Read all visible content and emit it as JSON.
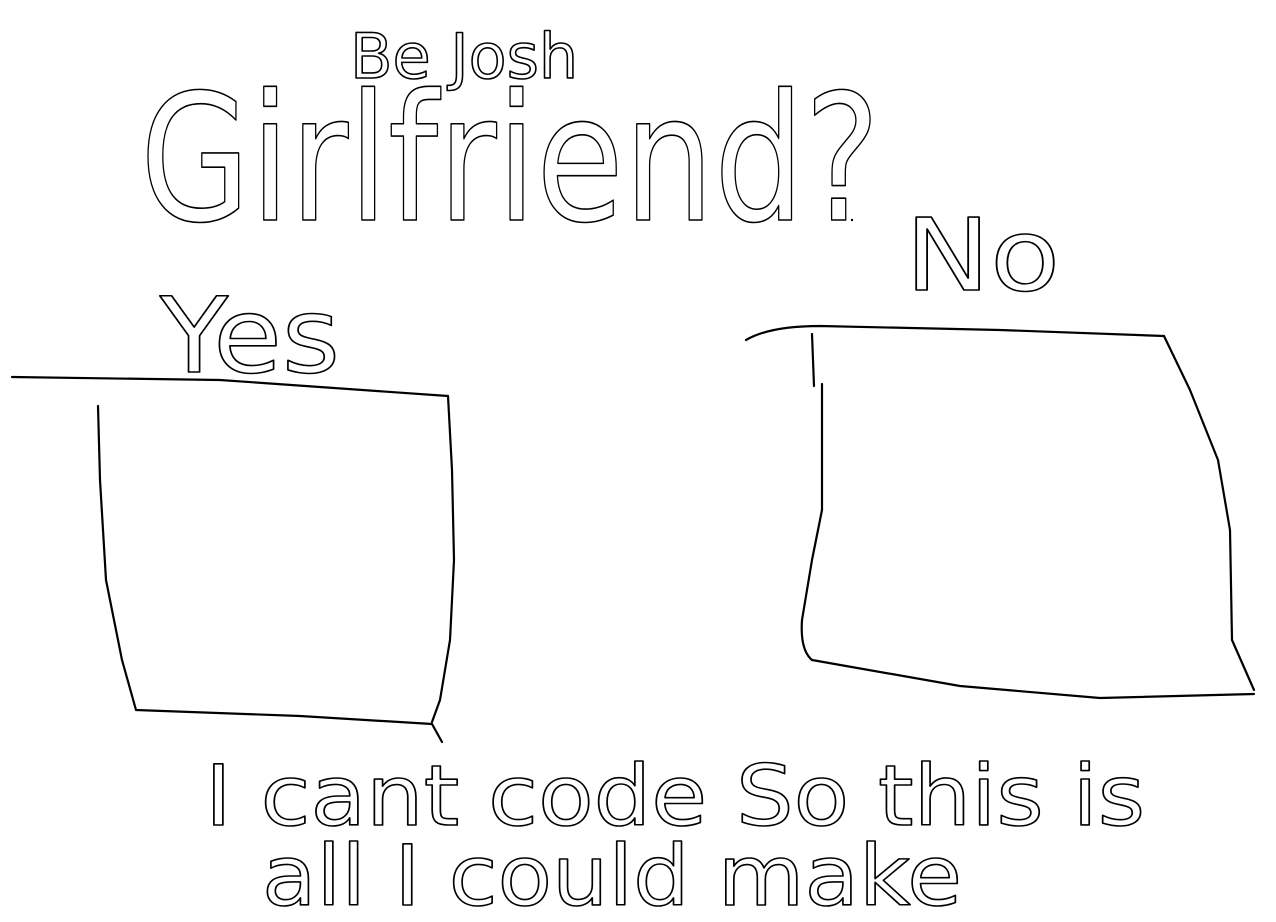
{
  "question": {
    "line1": "Be Josh",
    "line2": "Girlfriend?"
  },
  "options": {
    "yes_label": "Yes",
    "no_label": "No"
  },
  "footer": {
    "line1": "I cant code  So this is",
    "line2": "all I could make"
  },
  "colors": {
    "ink": "#000000",
    "paper": "#ffffff"
  }
}
